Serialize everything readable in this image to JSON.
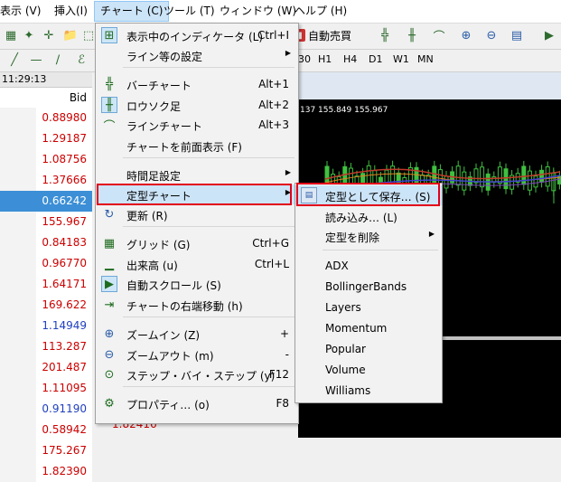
{
  "menubar": {
    "items": [
      "表示 (V)",
      "挿入(I)",
      "チャート (C)",
      "ツール (T)",
      "ウィンドウ (W)",
      "ヘルプ (H)"
    ]
  },
  "toolbar": {
    "autotrade_label": "自動売買"
  },
  "timeframes": [
    "30",
    "H1",
    "H4",
    "D1",
    "W1",
    "MN"
  ],
  "market_watch": {
    "time": "11:29:13",
    "bid_header": "Bid",
    "rows": [
      {
        "bid": "0.88980",
        "color": "#cc0000",
        "selected": false
      },
      {
        "bid": "1.29187",
        "color": "#cc0000",
        "selected": false
      },
      {
        "bid": "1.08756",
        "color": "#cc0000",
        "selected": false
      },
      {
        "bid": "1.37666",
        "color": "#cc0000",
        "selected": false
      },
      {
        "bid": "0.66242",
        "color": "#ffffff",
        "selected": true
      },
      {
        "bid": "155.967",
        "color": "#cc0000",
        "selected": false
      },
      {
        "bid": "0.84183",
        "color": "#cc0000",
        "selected": false
      },
      {
        "bid": "0.96770",
        "color": "#cc0000",
        "selected": false
      },
      {
        "bid": "1.64171",
        "color": "#cc0000",
        "selected": false
      },
      {
        "bid": "169.622",
        "color": "#cc0000",
        "selected": false
      },
      {
        "bid": "1.14949",
        "color": "#1f3fbf",
        "selected": false
      },
      {
        "bid": "113.287",
        "color": "#cc0000",
        "selected": false
      },
      {
        "bid": "201.487",
        "color": "#cc0000",
        "selected": false
      },
      {
        "bid": "1.11095",
        "color": "#cc0000",
        "selected": false
      },
      {
        "bid": "0.91190",
        "color": "#1f3fbf",
        "selected": false
      },
      {
        "bid": "0.58942",
        "color": "#cc0000",
        "selected": false
      },
      {
        "bid": "175.267",
        "color": "#cc0000",
        "selected": false
      },
      {
        "bid": "1.82390",
        "color": "#cc0000",
        "selected": false
      }
    ],
    "last_ask": "1.82416"
  },
  "chart": {
    "title": "137 155.849 155.967"
  },
  "chart_menu": {
    "items": [
      {
        "label": "表示中のインディケータ (L)",
        "shortcut": "Ctrl+I",
        "icon": "indicators-icon"
      },
      {
        "label": "ライン等の設定",
        "submenu": true
      },
      {
        "label": "バーチャート",
        "shortcut": "Alt+1",
        "icon": "bar-chart-icon"
      },
      {
        "label": "ロウソク足",
        "shortcut": "Alt+2",
        "icon": "candlestick-icon"
      },
      {
        "label": "ラインチャート",
        "shortcut": "Alt+3",
        "icon": "line-chart-icon"
      },
      {
        "label": "チャートを前面表示 (F)"
      },
      {
        "label": "時間足設定",
        "submenu": true
      },
      {
        "label": "定型チャート",
        "submenu": true,
        "highlighted": true
      },
      {
        "label": "更新 (R)",
        "icon": "refresh-icon"
      },
      {
        "label": "グリッド (G)",
        "shortcut": "Ctrl+G",
        "icon": "grid-icon"
      },
      {
        "label": "出来高 (u)",
        "shortcut": "Ctrl+L",
        "icon": "volume-icon"
      },
      {
        "label": "自動スクロール (S)",
        "icon": "auto-scroll-icon"
      },
      {
        "label": "チャートの右端移動 (h)",
        "icon": "chart-shift-icon"
      },
      {
        "label": "ズームイン (Z)",
        "shortcut": "+",
        "icon": "zoom-in-icon"
      },
      {
        "label": "ズームアウト (m)",
        "shortcut": "-",
        "icon": "zoom-out-icon"
      },
      {
        "label": "ステップ・バイ・ステップ (y)",
        "shortcut": "F12",
        "icon": "step-icon"
      },
      {
        "label": "プロパティ… (o)",
        "shortcut": "F8",
        "icon": "properties-icon"
      }
    ]
  },
  "template_submenu": {
    "items": [
      {
        "label": "定型として保存… (S)",
        "highlighted": true
      },
      {
        "label": "読み込み… (L)"
      },
      {
        "label": "定型を削除",
        "submenu": true
      },
      {
        "label": "ADX"
      },
      {
        "label": "BollingerBands"
      },
      {
        "label": "Layers"
      },
      {
        "label": "Momentum"
      },
      {
        "label": "Popular"
      },
      {
        "label": "Volume"
      },
      {
        "label": "Williams"
      }
    ]
  }
}
